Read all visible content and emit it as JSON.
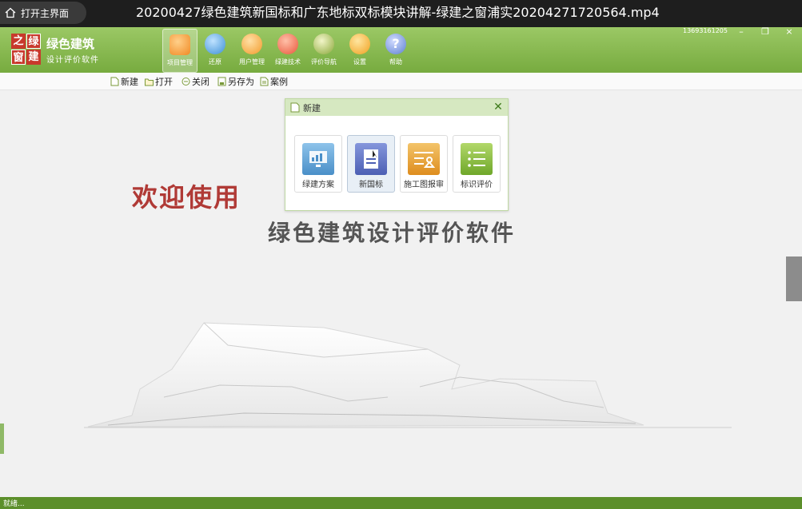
{
  "player": {
    "home_button_label": "打开主界面",
    "video_title": "20200427绿色建筑新国标和广东地标双标模块讲解-绿建之窗浦实20204271720564.mp4"
  },
  "app": {
    "logo_chars": [
      "之",
      "绿",
      "窗",
      "建"
    ],
    "brand_title": "绿色建筑",
    "brand_subtitle": "设计评价软件",
    "user_info": "13693161205",
    "window_controls": {
      "minimize": "–",
      "restore": "❐",
      "close": "×"
    },
    "toolbar": [
      {
        "label": "项目管理",
        "icon": "folder-icon",
        "color": "#f08a24"
      },
      {
        "label": "还原",
        "icon": "restore-icon",
        "color": "#3b8fd6"
      },
      {
        "label": "用户管理",
        "icon": "user-icon",
        "color": "#f29a2a"
      },
      {
        "label": "绿建技术",
        "icon": "tech-icon",
        "color": "#e8553a"
      },
      {
        "label": "评价导航",
        "icon": "navigation-icon",
        "color": "#8aa83a"
      },
      {
        "label": "设置",
        "icon": "gear-icon",
        "color": "#f0a020"
      },
      {
        "label": "帮助",
        "icon": "help-icon",
        "color": "#5b7fd0"
      }
    ],
    "subtoolbar": [
      {
        "label": "新建",
        "icon": "new-file-icon"
      },
      {
        "label": "打开",
        "icon": "open-folder-icon"
      },
      {
        "label": "关闭",
        "icon": "close-circle-icon"
      },
      {
        "label": "另存为",
        "icon": "save-as-icon"
      },
      {
        "label": "案例",
        "icon": "case-icon"
      }
    ]
  },
  "welcome": {
    "greeting": "欢迎使用",
    "software_name": "绿色建筑设计评价软件"
  },
  "dialog": {
    "title": "新建",
    "close": "✕",
    "options": [
      {
        "label": "绿建方案",
        "icon": "chart-screen-icon",
        "color": "#5a9fd4"
      },
      {
        "label": "新国标",
        "icon": "document-icon",
        "color": "#5b6fc2"
      },
      {
        "label": "施工图报审",
        "icon": "drawing-review-icon",
        "color": "#e49a2c"
      },
      {
        "label": "标识评价",
        "icon": "checklist-icon",
        "color": "#7fb43a"
      }
    ]
  },
  "status": {
    "text": "就绪..."
  },
  "colors": {
    "header_green": "#77ab3f",
    "welcome_red": "#b03a36",
    "status_green": "#5c8f2b"
  }
}
